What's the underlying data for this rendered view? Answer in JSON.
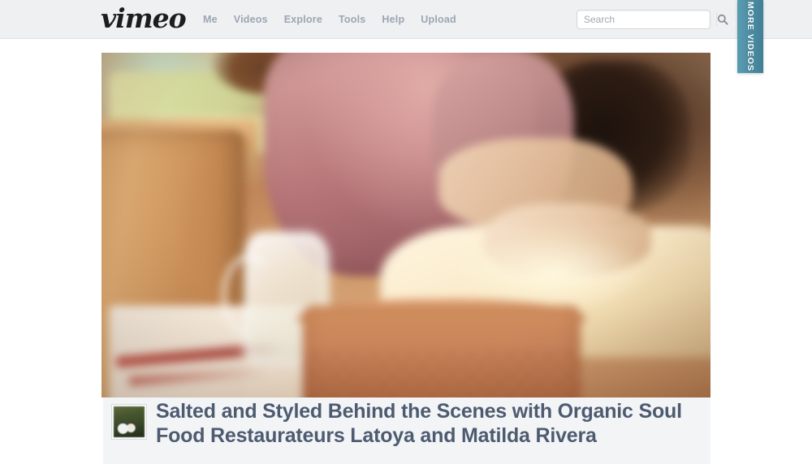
{
  "header": {
    "logo_text": "vimeo",
    "nav": [
      {
        "label": "Me"
      },
      {
        "label": "Videos"
      },
      {
        "label": "Explore"
      },
      {
        "label": "Tools"
      },
      {
        "label": "Help"
      },
      {
        "label": "Upload"
      }
    ],
    "search": {
      "value": "",
      "placeholder": "Search",
      "icon": "search-icon"
    },
    "background_color": "#eff0f2",
    "nav_link_color": "#9ba6b2",
    "logo_color": "#1a1f1d"
  },
  "more_videos_tab": {
    "label": "MORE VIDEOS",
    "color": "#4b8ca3",
    "text_color": "#ffffff"
  },
  "player": {
    "state": "playing",
    "scene_description": "Blurred kitchen scene: person in pink sweater, hands on a bright table, glass pitcher and a woven basket of beans in the foreground"
  },
  "info_panel": {
    "thumbnail_alt": "video-thumbnail",
    "title": "Salted and Styled Behind the Scenes with Organic Soul Food Restaurateurs Latoya and Matilda Rivera",
    "title_color": "#4d5b71",
    "background_color": "#f3f4f6"
  }
}
